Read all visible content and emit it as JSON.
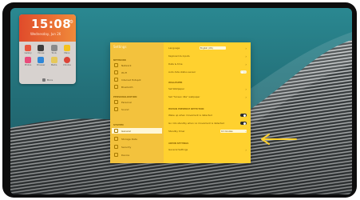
{
  "widget": {
    "time": "15:08",
    "date": "Wednesday, Jun 26",
    "apps": [
      {
        "label": "Gallery",
        "color": "#e8553d"
      },
      {
        "label": "Mouse",
        "color": "#3c3c3c"
      },
      {
        "label": "Tools",
        "color": "#8a8a8a"
      },
      {
        "label": "Menu",
        "color": "#f4c21d"
      },
      {
        "label": "Photos",
        "color": "#e94b7a"
      },
      {
        "label": "Browser",
        "color": "#2f87d8"
      },
      {
        "label": "Media",
        "color": "#e6c85a"
      },
      {
        "label": "Chrome",
        "color": "#dc4437"
      }
    ],
    "footer_label": "More"
  },
  "settings": {
    "title": "Settings",
    "sidebar": {
      "sections": [
        {
          "label": "NETWORK",
          "items": [
            {
              "label": "Network",
              "icon": "network-icon"
            },
            {
              "label": "Wi-Fi",
              "icon": "wifi-icon"
            },
            {
              "label": "Internet Hotspot",
              "icon": "hotspot-icon"
            },
            {
              "label": "Bluetooth",
              "icon": "bluetooth-icon"
            }
          ]
        },
        {
          "label": "PERSONALIZATION",
          "items": [
            {
              "label": "Personal",
              "icon": "personal-icon"
            },
            {
              "label": "Sound",
              "icon": "sound-icon"
            }
          ]
        },
        {
          "label": "SYSTEM",
          "items": [
            {
              "label": "General",
              "icon": "general-icon",
              "active": true
            },
            {
              "label": "Storage Data",
              "icon": "storage-icon"
            },
            {
              "label": "Security",
              "icon": "security-icon"
            },
            {
              "label": "Device",
              "icon": "device-icon"
            }
          ]
        }
      ]
    },
    "main": {
      "language_label": "Language",
      "language_value": "English (US)",
      "keyboard_label": "Keyboard & Inputs",
      "datetime_label": "Date & time",
      "auto_hide_label": "Auto-hide status sensor",
      "wallpaper_section": "WALLPAPER",
      "set_wallpaper_label": "Set Wallpaper",
      "set_idle_label": "Set \"Screen Idle\" wallpaper",
      "human_section": "HUMAN PRESENCE DETECTION",
      "wake_label": "Wake up when movement is detected",
      "standby_label": "Go into standby when no movement is detected",
      "standby_timer_label": "Standby timer",
      "standby_timer_value": "10 minutes",
      "admin_section": "ADMIN SETTINGS",
      "general_label": "General Settings"
    },
    "toggles": {
      "auto_hide": false,
      "wake": true,
      "standby": true
    }
  },
  "colors": {
    "accent": "#ffd12f",
    "sidebar": "#f3c23d",
    "arrow": "#ffd12f"
  }
}
